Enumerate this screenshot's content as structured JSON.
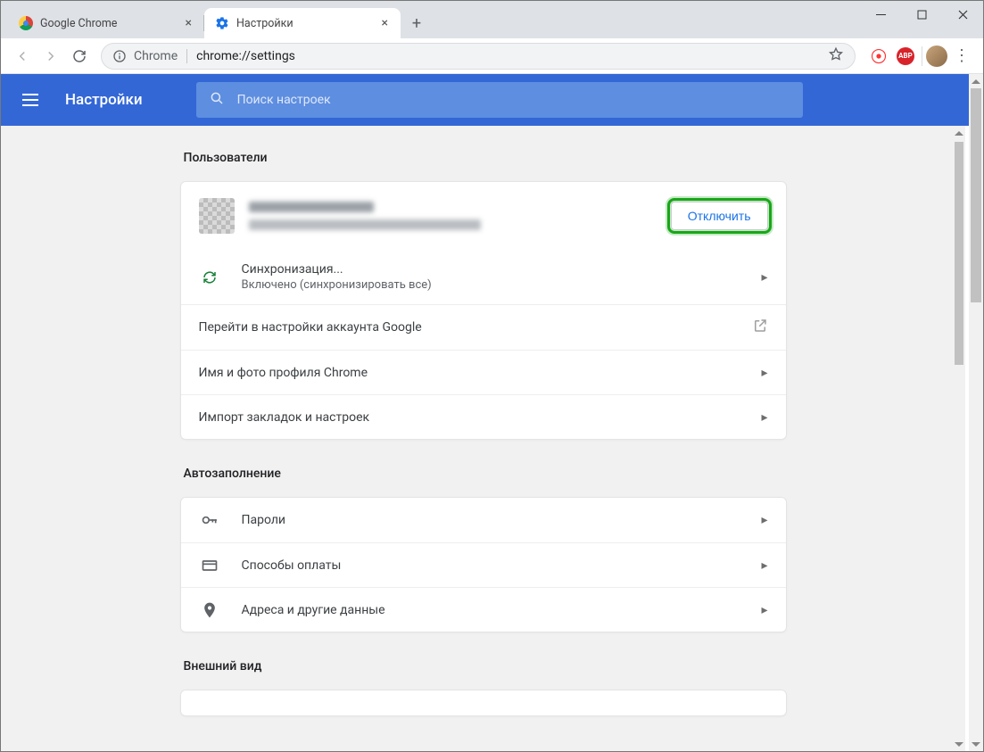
{
  "window": {
    "tabs": [
      {
        "title": "Google Chrome",
        "active": false
      },
      {
        "title": "Настройки",
        "active": true
      }
    ]
  },
  "omnibox": {
    "scheme_label": "Chrome",
    "url": "chrome://settings"
  },
  "header": {
    "title": "Настройки",
    "search_placeholder": "Поиск настроек"
  },
  "sections": {
    "users": {
      "title": "Пользователи",
      "disconnect": "Отключить",
      "sync_title": "Синхронизация...",
      "sync_status": "Включено (синхронизировать все)",
      "google_account": "Перейти в настройки аккаунта Google",
      "name_photo": "Имя и фото профиля Chrome",
      "import": "Импорт закладок и настроек"
    },
    "autofill": {
      "title": "Автозаполнение",
      "passwords": "Пароли",
      "payment": "Способы оплаты",
      "addresses": "Адреса и другие данные"
    },
    "appearance": {
      "title": "Внешний вид"
    }
  }
}
